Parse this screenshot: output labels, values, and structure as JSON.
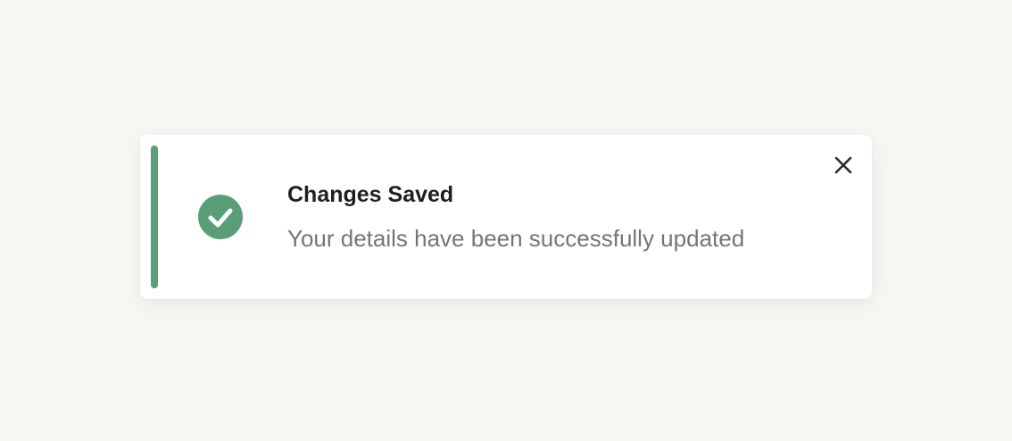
{
  "toast": {
    "title": "Changes Saved",
    "message": "Your details have been successfully updated",
    "status_icon": "check-circle-icon",
    "close_icon": "close-icon",
    "accent_color": "#5a9e77",
    "title_color": "#1f1f1f",
    "message_color": "#757575"
  },
  "page": {
    "background_color": "#f7f6f3"
  }
}
